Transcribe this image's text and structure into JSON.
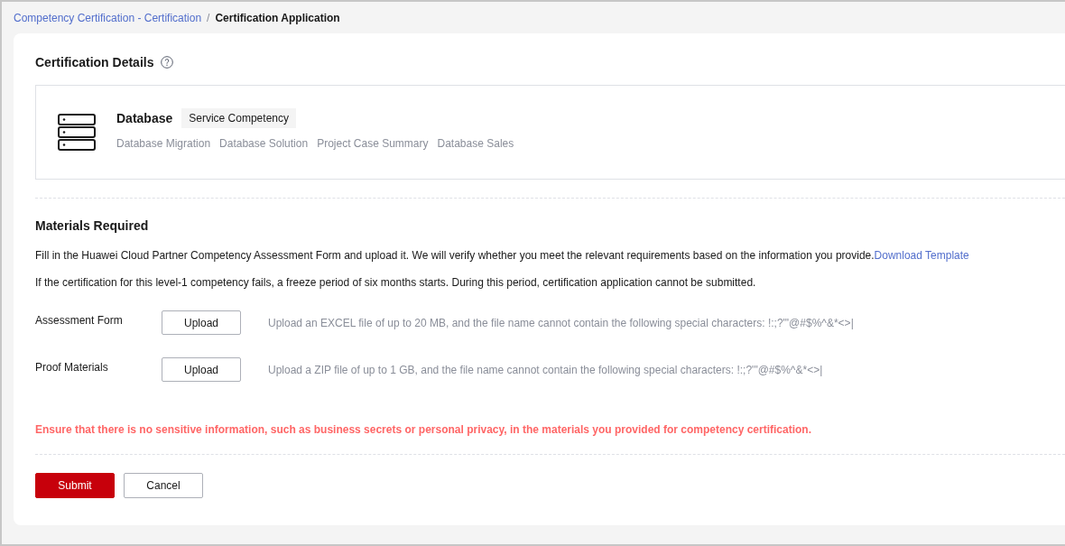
{
  "breadcrumb": [
    {
      "label": "Competency Certification - Certification",
      "kind": "link",
      "separator": "/"
    },
    {
      "label": "Certification Application",
      "kind": "current"
    }
  ],
  "details": {
    "title": "Certification Details",
    "name": "Database",
    "tag": "Service Competency",
    "topics": [
      "Database Migration",
      "Database Solution",
      "Project Case Summary",
      "Database Sales"
    ]
  },
  "materials": {
    "title": "Materials Required",
    "instructions": [
      {
        "text": "Fill in the Huawei Cloud Partner Competency Assessment Form and upload it. We will verify whether you meet the relevant requirements based on the information you provide.",
        "link": "Download Template"
      },
      {
        "text": "If the certification for this level-1 competency fails, a freeze period of six months starts. During this period, certification application cannot be submitted."
      }
    ],
    "uploads": [
      {
        "label": "Assessment Form",
        "button": "Upload",
        "hint": "Upload an EXCEL file of up to 20 MB, and the file name cannot contain the following special characters: !:;?'\"@#$%^&*<>|"
      },
      {
        "label": "Proof Materials",
        "button": "Upload",
        "hint": "Upload a ZIP file of up to 1 GB, and the file name cannot contain the following special characters: !:;?'\"@#$%^&*<>|"
      }
    ],
    "warning": "Ensure that there is no sensitive information, such as business secrets or personal privacy, in the materials you provided for competency certification."
  },
  "actions": [
    {
      "label": "Submit",
      "kind": "primary"
    },
    {
      "label": "Cancel",
      "kind": "secondary"
    }
  ]
}
